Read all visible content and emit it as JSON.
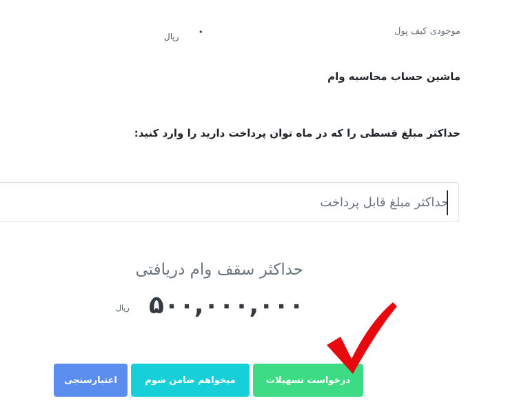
{
  "wallet": {
    "label": "موجودی کیف پول",
    "value": "۰",
    "unit": "ریال"
  },
  "calculator": {
    "title": "ماشین حساب محاسبه وام",
    "instruction": "حداکثر مبلغ قسطی را که در ماه توان پرداخت دارید را وارد کنید:"
  },
  "input": {
    "placeholder": "حداکثر مبلغ قابل پرداخت",
    "value": ""
  },
  "result": {
    "heading": "حداکثر سقف وام دریافتی",
    "amount": "۵۰۰,۰۰۰,۰۰۰",
    "unit": "ریال"
  },
  "buttons": {
    "facilities": "درخواست تسهیلات",
    "guarantor": "میخواهم ضامن شوم",
    "validation": "اعتبارسنجی"
  },
  "colors": {
    "facilities_button": "#3ddc84",
    "guarantor_button": "#17cfd8",
    "validation_button": "#5b8def",
    "checkmark": "#e8090f"
  },
  "icons": {
    "annotation": "checkmark-icon"
  }
}
